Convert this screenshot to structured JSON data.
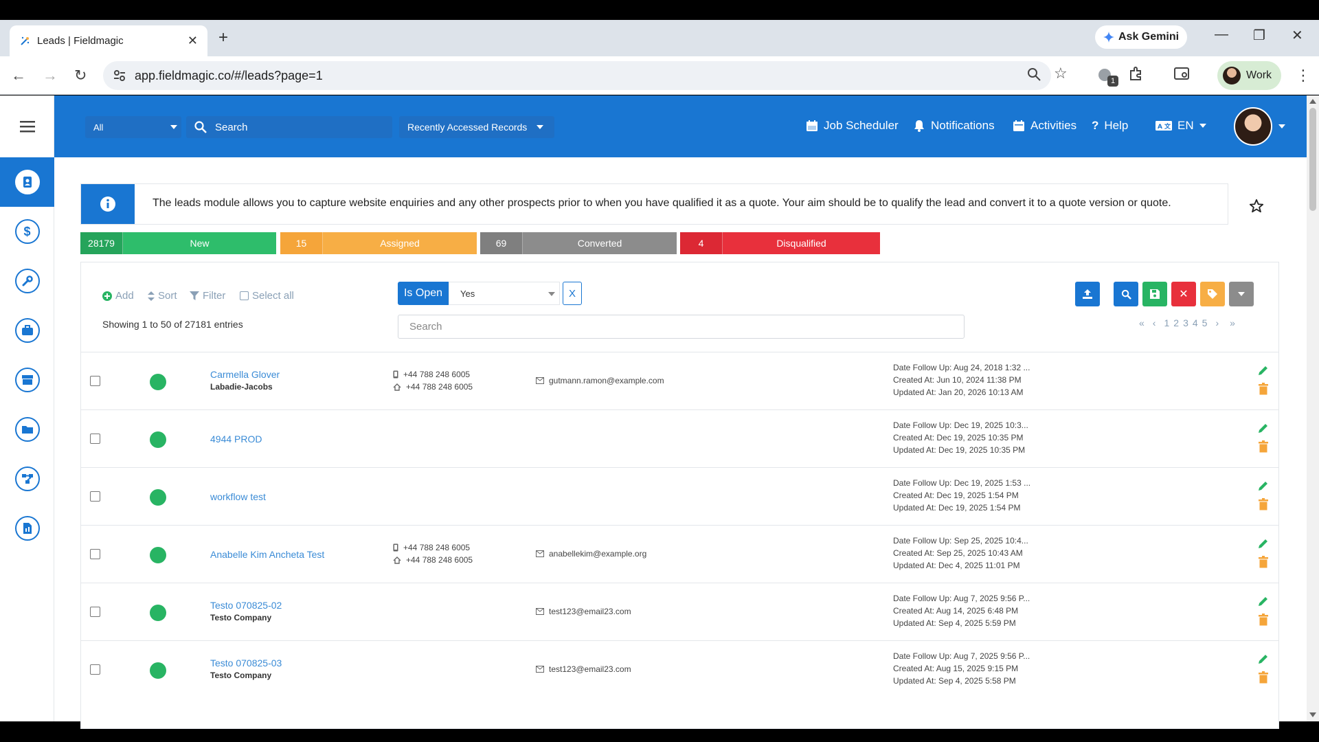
{
  "browser": {
    "tab_title": "Leads | Fieldmagic",
    "gemini_label": "Ask Gemini",
    "url": "app.fieldmagic.co/#/leads?page=1",
    "extension_badge": "1",
    "profile_label": "Work"
  },
  "topnav": {
    "scope_value": "All",
    "search_placeholder": "Search",
    "recent_label": "Recently Accessed Records",
    "links": {
      "job_scheduler": "Job Scheduler",
      "notifications": "Notifications",
      "activities": "Activities",
      "help": "Help",
      "language": "EN"
    }
  },
  "info": {
    "text": "The leads module allows you to capture website enquiries and any other prospects prior to when you have qualified it as a quote. Your aim should be to qualify the lead and convert it to a quote version or quote."
  },
  "status_filters": [
    {
      "count": "28179",
      "label": "New",
      "color": "#2ebd6b",
      "count_color": "#25a45b"
    },
    {
      "count": "15",
      "label": "Assigned",
      "color": "#f7ae45",
      "count_color": "#f5a53a"
    },
    {
      "count": "69",
      "label": "Converted",
      "color": "#8c8c8c",
      "count_color": "#7f7f7f"
    },
    {
      "count": "4",
      "label": "Disqualified",
      "color": "#e8303c",
      "count_color": "#dc2834"
    }
  ],
  "toolbar": {
    "add": "Add",
    "sort": "Sort",
    "filter": "Filter",
    "select_all": "Select all",
    "showing": "Showing 1 to 50 of 27181 entries",
    "filter_chip": "Is Open",
    "filter_value": "Yes",
    "filter_clear": "X",
    "search_placeholder": "Search"
  },
  "pagination": {
    "pages": [
      "1",
      "2",
      "3",
      "4",
      "5"
    ]
  },
  "rows": [
    {
      "name": "Carmella Glover",
      "company": "Labadie-Jacobs",
      "mobile": "+44 788 248 6005",
      "phone": "+44 788 248 6005",
      "email": "gutmann.ramon@example.com",
      "follow_up": "Date Follow Up: Aug 24, 2018 1:32 ...",
      "created": "Created At: Jun 10, 2024 11:38 PM",
      "updated": "Updated At: Jan 20, 2026 10:13 AM"
    },
    {
      "name": "4944 PROD",
      "company": "",
      "mobile": "",
      "phone": "",
      "email": "",
      "follow_up": "Date Follow Up: Dec 19, 2025 10:3...",
      "created": "Created At: Dec 19, 2025 10:35 PM",
      "updated": "Updated At: Dec 19, 2025 10:35 PM"
    },
    {
      "name": "workflow test",
      "company": "",
      "mobile": "",
      "phone": "",
      "email": "",
      "follow_up": "Date Follow Up: Dec 19, 2025 1:53 ...",
      "created": "Created At: Dec 19, 2025 1:54 PM",
      "updated": "Updated At: Dec 19, 2025 1:54 PM"
    },
    {
      "name": "Anabelle Kim Ancheta Test",
      "company": "",
      "mobile": "+44 788 248 6005",
      "phone": "+44 788 248 6005",
      "email": "anabellekim@example.org",
      "follow_up": "Date Follow Up: Sep 25, 2025 10:4...",
      "created": "Created At: Sep 25, 2025 10:43 AM",
      "updated": "Updated At: Dec 4, 2025 11:01 PM"
    },
    {
      "name": "Testo 070825-02",
      "company": "Testo Company",
      "mobile": "",
      "phone": "",
      "email": "test123@email23.com",
      "follow_up": "Date Follow Up: Aug 7, 2025 9:56 P...",
      "created": "Created At: Aug 14, 2025 6:48 PM",
      "updated": "Updated At: Sep 4, 2025 5:59 PM"
    },
    {
      "name": "Testo 070825-03",
      "company": "Testo Company",
      "mobile": "",
      "phone": "",
      "email": "test123@email23.com",
      "follow_up": "Date Follow Up: Aug 7, 2025 9:56 P...",
      "created": "Created At: Aug 15, 2025 9:15 PM",
      "updated": "Updated At: Sep 4, 2025 5:58 PM"
    }
  ]
}
